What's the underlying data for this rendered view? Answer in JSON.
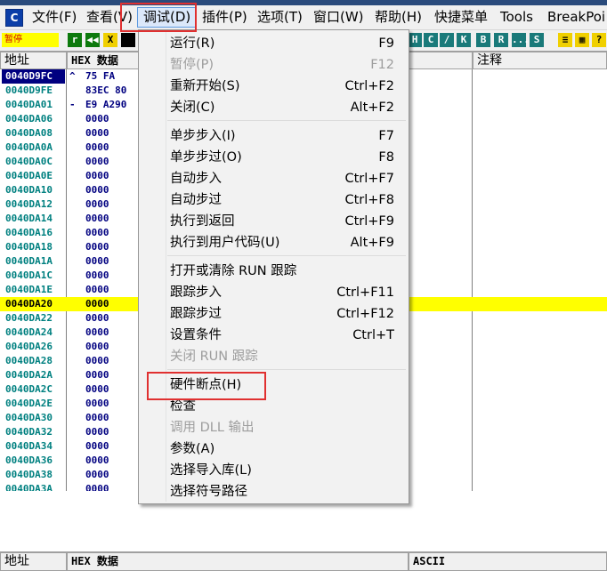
{
  "menubar": {
    "app_icon_letter": "C",
    "items": [
      "文件(F)",
      "查看(V)",
      "调试(D)",
      "插件(P)",
      "选项(T)",
      "窗口(W)",
      "帮助(H)",
      "快捷菜单",
      "Tools",
      "BreakPoi"
    ]
  },
  "toolbar": {
    "status": "暂停",
    "left_buttons": [
      "r",
      "◀◀",
      "X"
    ],
    "right_buttons": [
      "H",
      "C",
      "/",
      "K",
      "B",
      "R",
      "...",
      "S"
    ]
  },
  "cpu": {
    "headers": {
      "address": "地址",
      "hex": "HEX 数据",
      "comment": "注释"
    },
    "rows": [
      {
        "addr": "0040D9FC",
        "mark": "^",
        "hex": "75 FA"
      },
      {
        "addr": "0040D9FE",
        "mark": "",
        "hex": "83EC 80"
      },
      {
        "addr": "0040DA01",
        "mark": "-",
        "hex": "E9 A290"
      },
      {
        "addr": "0040DA06",
        "mark": "",
        "hex": "0000"
      },
      {
        "addr": "0040DA08",
        "mark": "",
        "hex": "0000"
      },
      {
        "addr": "0040DA0A",
        "mark": "",
        "hex": "0000"
      },
      {
        "addr": "0040DA0C",
        "mark": "",
        "hex": "0000"
      },
      {
        "addr": "0040DA0E",
        "mark": "",
        "hex": "0000"
      },
      {
        "addr": "0040DA10",
        "mark": "",
        "hex": "0000"
      },
      {
        "addr": "0040DA12",
        "mark": "",
        "hex": "0000"
      },
      {
        "addr": "0040DA14",
        "mark": "",
        "hex": "0000"
      },
      {
        "addr": "0040DA16",
        "mark": "",
        "hex": "0000"
      },
      {
        "addr": "0040DA18",
        "mark": "",
        "hex": "0000"
      },
      {
        "addr": "0040DA1A",
        "mark": "",
        "hex": "0000"
      },
      {
        "addr": "0040DA1C",
        "mark": "",
        "hex": "0000"
      },
      {
        "addr": "0040DA1E",
        "mark": "",
        "hex": "0000"
      },
      {
        "addr": "0040DA20",
        "mark": "",
        "hex": "0000"
      },
      {
        "addr": "0040DA22",
        "mark": "",
        "hex": "0000"
      },
      {
        "addr": "0040DA24",
        "mark": "",
        "hex": "0000"
      },
      {
        "addr": "0040DA26",
        "mark": "",
        "hex": "0000"
      },
      {
        "addr": "0040DA28",
        "mark": "",
        "hex": "0000"
      },
      {
        "addr": "0040DA2A",
        "mark": "",
        "hex": "0000"
      },
      {
        "addr": "0040DA2C",
        "mark": "",
        "hex": "0000"
      },
      {
        "addr": "0040DA2E",
        "mark": "",
        "hex": "0000"
      },
      {
        "addr": "0040DA30",
        "mark": "",
        "hex": "0000"
      },
      {
        "addr": "0040DA32",
        "mark": "",
        "hex": "0000"
      },
      {
        "addr": "0040DA34",
        "mark": "",
        "hex": "0000"
      },
      {
        "addr": "0040DA36",
        "mark": "",
        "hex": "0000"
      },
      {
        "addr": "0040DA38",
        "mark": "",
        "hex": "0000"
      },
      {
        "addr": "0040DA3A",
        "mark": "",
        "hex": "0000"
      }
    ]
  },
  "dump": {
    "headers": {
      "address": "地址",
      "hex": "HEX 数据",
      "ascii": "ASCII"
    }
  },
  "debug_menu": {
    "items": [
      {
        "label": "运行(R)",
        "shortcut": "F9",
        "enabled": true
      },
      {
        "label": "暂停(P)",
        "shortcut": "F12",
        "enabled": false
      },
      {
        "label": "重新开始(S)",
        "shortcut": "Ctrl+F2",
        "enabled": true
      },
      {
        "label": "关闭(C)",
        "shortcut": "Alt+F2",
        "enabled": true
      },
      {
        "label": "单步步入(I)",
        "shortcut": "F7",
        "enabled": true
      },
      {
        "label": "单步步过(O)",
        "shortcut": "F8",
        "enabled": true
      },
      {
        "label": "自动步入",
        "shortcut": "Ctrl+F7",
        "enabled": true
      },
      {
        "label": "自动步过",
        "shortcut": "Ctrl+F8",
        "enabled": true
      },
      {
        "label": "执行到返回",
        "shortcut": "Ctrl+F9",
        "enabled": true
      },
      {
        "label": "执行到用户代码(U)",
        "shortcut": "Alt+F9",
        "enabled": true
      },
      {
        "label": "打开或清除 RUN 跟踪",
        "shortcut": "",
        "enabled": true
      },
      {
        "label": "跟踪步入",
        "shortcut": "Ctrl+F11",
        "enabled": true
      },
      {
        "label": "跟踪步过",
        "shortcut": "Ctrl+F12",
        "enabled": true
      },
      {
        "label": "设置条件",
        "shortcut": "Ctrl+T",
        "enabled": true
      },
      {
        "label": "关闭 RUN 跟踪",
        "shortcut": "",
        "enabled": false
      },
      {
        "label": "硬件断点(H)",
        "shortcut": "",
        "enabled": true
      },
      {
        "label": "检查",
        "shortcut": "",
        "enabled": true
      },
      {
        "label": "调用 DLL 输出",
        "shortcut": "",
        "enabled": false
      },
      {
        "label": "参数(A)",
        "shortcut": "",
        "enabled": true
      },
      {
        "label": "选择导入库(L)",
        "shortcut": "",
        "enabled": true
      },
      {
        "label": "选择符号路径",
        "shortcut": "",
        "enabled": true
      }
    ]
  },
  "colors": {
    "annotation": "#e03030",
    "highlight_row": "#ffff00",
    "address_text": "#008080",
    "selected_address_bg": "#000080"
  }
}
